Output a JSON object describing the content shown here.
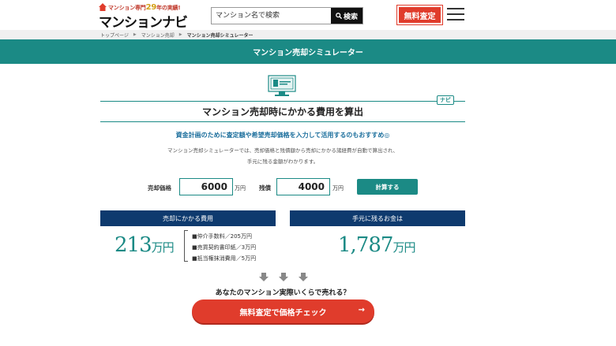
{
  "header": {
    "logo_tagline_prefix": "マンション専門",
    "logo_tagline_years": "29",
    "logo_tagline_suffix": "年の実績!",
    "logo_name": "マンションナビ",
    "search_placeholder": "マンション名で検索",
    "search_button": "検索",
    "free_assessment": "無料査定"
  },
  "breadcrumb": {
    "items": [
      "トップページ",
      "マンション売却",
      "マンション売却シミュレーター"
    ]
  },
  "title_bar": "マンション売却シミュレーター",
  "navi_tag": "ナビ",
  "section_heading": "マンション売却時にかかる費用を算出",
  "lead": "資金計画のために査定額や希望売却価格を入力して活用するのもおすすめ◎",
  "description": {
    "line1": "マンション売却シミュレーターでは、売却価格と残債額から売却にかかる諸経費が自動で算出され、",
    "line2": "手元に残る金額がわかります。"
  },
  "form": {
    "price_label": "売却価格",
    "price_value": "6000",
    "price_unit": "万円",
    "debt_label": "残債",
    "debt_value": "4000",
    "debt_unit": "万円",
    "calc_button": "計算する"
  },
  "results": {
    "cost_header": "売却にかかる費用",
    "cost_amount": "213",
    "cost_unit": "万円",
    "breakdown": [
      "■仲介手数料／205万円",
      "■売買契約書印紙／3万円",
      "■抵当権抹消費用／5万円"
    ],
    "remain_header": "手元に残るお金は",
    "remain_amount": "1,787",
    "remain_unit": "万円"
  },
  "question": "あなたのマンション実際いくらで売れる？",
  "cta": {
    "label": "無料査定で価格チェック",
    "arrow": "→"
  },
  "colors": {
    "teal": "#1b8a85",
    "navy": "#0e3a6e",
    "red": "#e03c2c"
  }
}
